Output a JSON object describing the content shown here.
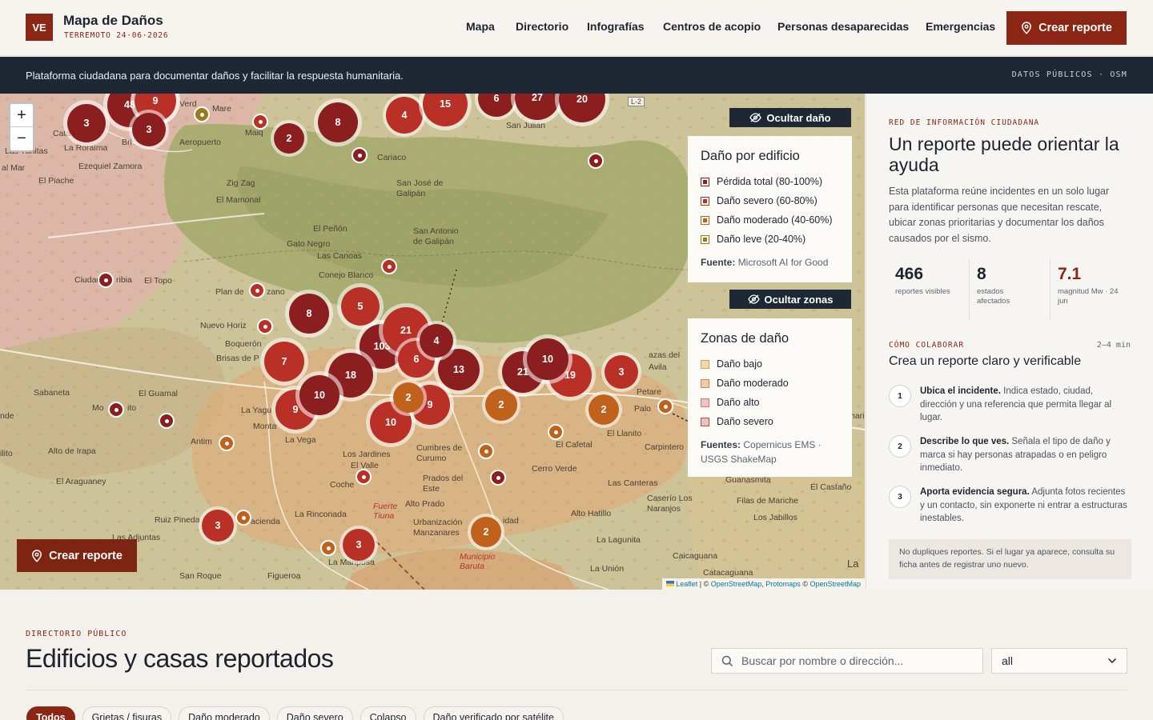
{
  "header": {
    "logo": "VE",
    "title": "Mapa de Daños",
    "subtitle": "TERREMOTO 24·06·2026",
    "nav": [
      "Mapa",
      "Directorio",
      "Infografías",
      "Centros de acopio",
      "Personas desaparecidas",
      "Emergencias"
    ],
    "cta": "Crear reporte"
  },
  "strip": {
    "text": "Plataforma ciudadana para documentar daños y facilitar la respuesta humanitaria.",
    "tag": "DATOS PÚBLICOS · OSM"
  },
  "map": {
    "zoom_in": "+",
    "zoom_out": "−",
    "hide_damage": "Ocultar daño",
    "hide_zones": "Ocultar zonas",
    "cta": "Crear reporte",
    "damage_legend": {
      "title": "Daño por edificio",
      "items": [
        {
          "label": "Pérdida total (80-100%)",
          "color": "#8b1f1f"
        },
        {
          "label": "Daño severo (60-80%)",
          "color": "#b93026"
        },
        {
          "label": "Daño moderado (40-60%)",
          "color": "#c0611c"
        },
        {
          "label": "Daño leve (20-40%)",
          "color": "#9a7a1c"
        }
      ],
      "source_label": "Fuente:",
      "source": "Microsoft AI for Good"
    },
    "zone_legend": {
      "title": "Zonas de daño",
      "items": [
        {
          "label": "Daño bajo",
          "color": "#f2d9a6",
          "border": "#c9a65a"
        },
        {
          "label": "Daño moderado",
          "color": "#f2c9a8",
          "border": "#c98a4e"
        },
        {
          "label": "Daño alto",
          "color": "#f2c3bc",
          "border": "#c47a6e"
        },
        {
          "label": "Daño severo",
          "color": "#efc0c0",
          "border": "#a8554f"
        }
      ],
      "source_label": "Fuentes:",
      "source": "Copernicus EMS · USGS ShakeMap"
    },
    "attribution": {
      "leaflet": "Leaflet",
      "osm1": "OpenStreetMap",
      "protomaps": "Protomaps",
      "osm2": "OpenStreetMap"
    },
    "places": [
      "Cata",
      "La Roraima",
      "Las Tunitas",
      "al Mar",
      "Ezequiel Zamora",
      "El Piache",
      "Mare",
      "Aeropuerto",
      "Verd",
      "Maiq",
      "Bri",
      "Zig Zag",
      "El Mamonal",
      "Cariaco",
      "San José de Galipán",
      "San Julián",
      "El Peñón",
      "Gato Negro",
      "Las Canoas",
      "San Antonio de Galipán",
      "Conejo Blanco",
      "Ciudad",
      "ribia",
      "El Topo",
      "Plan de",
      "zano",
      "Nuevo Horiz",
      "Boquerón",
      "Brisas de P",
      "Sabaneta",
      "El Guamal",
      "nde",
      "Mo",
      "ito",
      "La Yagu",
      "Monta",
      "La Vega",
      "Antim",
      "Alto de Irapa",
      "ilito",
      "El Araguaney",
      "Los Jardines",
      "El Valle",
      "Cumbres de Curumo",
      "Prados del Este",
      "Coche",
      "Alto Prado",
      "La Rinconada",
      "Ruiz Pineda",
      "acienda",
      "Las Adjuntas",
      "San Roque",
      "Figueroa",
      "La Mariposa",
      "Urbanización Manzanares",
      "Fuerte Tiuna",
      "Municipio Baruta",
      "El Cafetal",
      "Cerro Verde",
      "El Llanito",
      "Petare",
      "Palo",
      "Carpintero",
      "azas del",
      "Avila",
      "Las Canteras",
      "Caserío Los Naranjos",
      "Alto Hatillo",
      "La Lagunita",
      "Guanasmita",
      "El Castaño",
      "Filas de Mariche",
      "Los Jabillos",
      "Caicaguana",
      "Catacaguana",
      "La Unión",
      "La",
      "L-2",
      "hari",
      "idad"
    ],
    "clusters": [
      "3",
      "48",
      "9",
      "3",
      "2",
      "8",
      "4",
      "15",
      "6",
      "27",
      "20",
      "8",
      "5",
      "21",
      "103",
      "4",
      "7",
      "6",
      "13",
      "18",
      "10",
      "9",
      "2",
      "10",
      "9",
      "2",
      "21",
      "10",
      "19",
      "3",
      "2",
      "3",
      "3",
      "2"
    ]
  },
  "side": {
    "kicker": "RED DE INFORMACIÓN CIUDADANA",
    "title": "Un reporte puede orientar la ayuda",
    "intro": "Esta plataforma reúne incidentes en un solo lugar para identificar personas que necesitan rescate, ubicar zonas prioritarias y documentar los daños causados por el sismo.",
    "stats": [
      {
        "value": "466",
        "label": "reportes visibles"
      },
      {
        "value": "8",
        "label": "estados afectados"
      },
      {
        "value": "7.1",
        "label": "magnitud Mw · 24 jun"
      }
    ],
    "how_kicker": "CÓMO COLABORAR",
    "how_time": "2–4 min",
    "how_title": "Crea un reporte claro y verificable",
    "steps": [
      {
        "n": "1",
        "bold": "Ubica el incidente.",
        "text": " Indica estado, ciudad, dirección y una referencia que permita llegar al lugar."
      },
      {
        "n": "2",
        "bold": "Describe lo que ves.",
        "text": " Señala el tipo de daño y marca si hay personas atrapadas o en peligro inmediato."
      },
      {
        "n": "3",
        "bold": "Aporta evidencia segura.",
        "text": " Adjunta fotos recientes y un contacto, sin exponerte ni entrar a estructuras inestables."
      }
    ],
    "note": "No dupliques reportes. Si el lugar ya aparece, consulta su ficha antes de registrar uno nuevo."
  },
  "directory": {
    "kicker": "DIRECTORIO PÚBLICO",
    "title": "Edificios y casas reportados",
    "search_placeholder": "Buscar por nombre o dirección...",
    "filter_value": "all",
    "chips": [
      "Todos",
      "Grietas / fisuras",
      "Daño moderado",
      "Daño severo",
      "Colapso",
      "Daño verificado por satélite"
    ]
  },
  "colors": {
    "brand": "#8b2514",
    "dark": "#1e2835",
    "cluster_total": "#8b1f1f",
    "cluster_severe": "#b93026",
    "cluster_moderate": "#c0611c",
    "cluster_light": "#9a7a1c"
  },
  "icons": [
    "pin-icon",
    "eye-off-icon",
    "search-icon",
    "chevron-down-icon",
    "ukraine-flag-icon"
  ]
}
